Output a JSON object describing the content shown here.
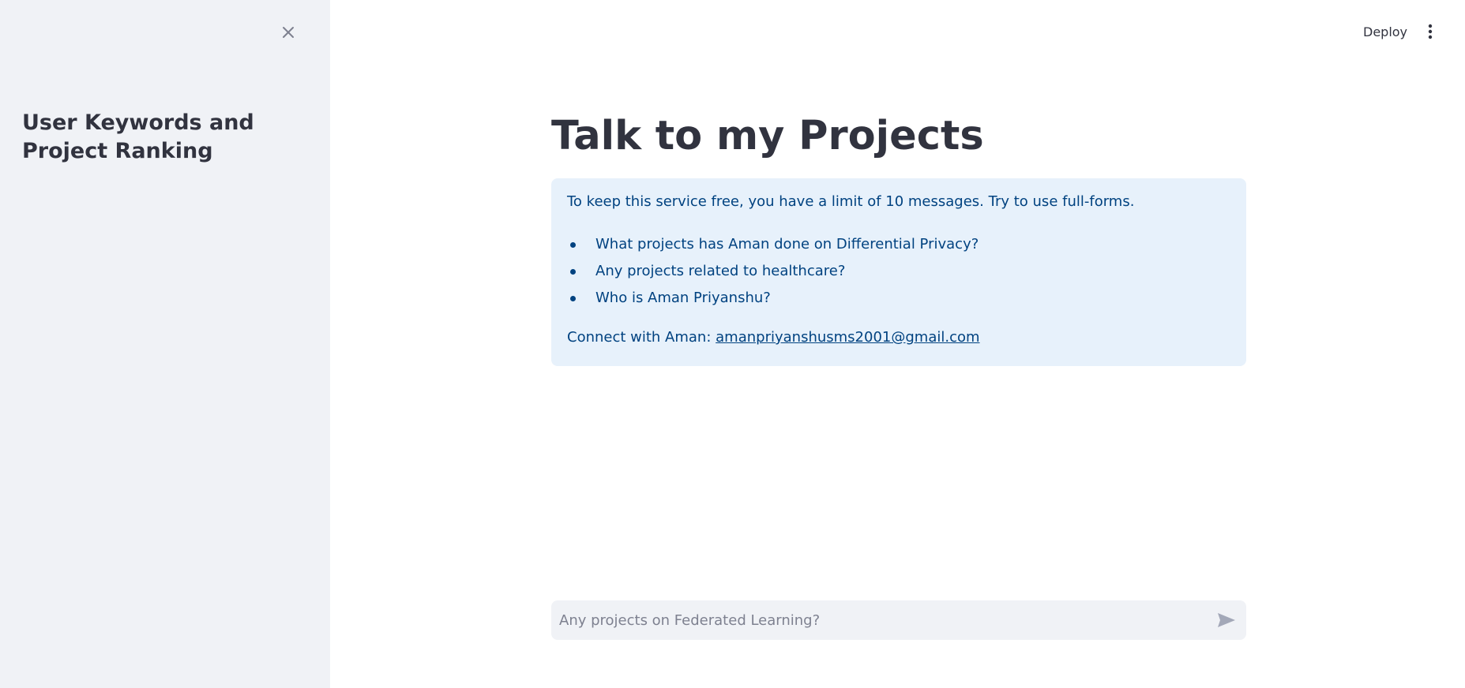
{
  "sidebar": {
    "close_icon": "close-icon",
    "title": "User Keywords and Project Ranking"
  },
  "topbar": {
    "deploy_label": "Deploy",
    "menu_icon": "kebab-menu-icon"
  },
  "main": {
    "title": "Talk to my Projects",
    "info": {
      "intro": "To keep this service free, you have a limit of 10 messages. Try to use full-forms.",
      "suggestions": [
        "What projects has Aman done on Differential Privacy?",
        "Any projects related to healthcare?",
        "Who is Aman Priyanshu?"
      ],
      "connect_label": "Connect with Aman:",
      "connect_email": "amanpriyanshusms2001@gmail.com"
    }
  },
  "chat": {
    "placeholder": "Any projects on Federated Learning?",
    "value": "",
    "send_icon": "send-icon"
  },
  "colors": {
    "sidebar_bg": "#f0f2f6",
    "info_bg": "#e7f1fb",
    "info_text": "#004280",
    "text_primary": "#31333f",
    "placeholder": "#7e8190"
  }
}
